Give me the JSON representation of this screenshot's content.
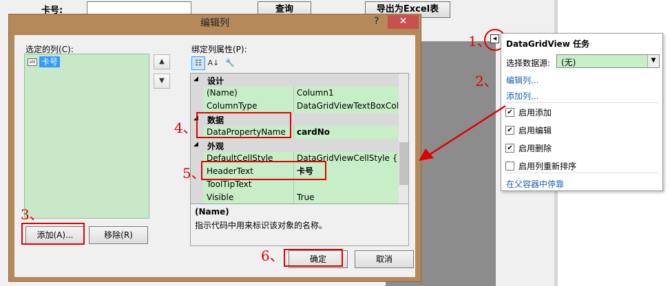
{
  "background_form": {
    "card_label": "卡号:",
    "query_button": "查询",
    "export_button": "导出为Excel表"
  },
  "dialog": {
    "title": "编辑列",
    "help_glyph": "?",
    "close_glyph": "✕",
    "selected_columns_label": "选定的列(C):",
    "list_items": [
      {
        "icon": "abl",
        "label": "卡号"
      }
    ],
    "move_up_glyph": "▲",
    "move_down_glyph": "▼",
    "bound_props_label": "绑定列属性(P):",
    "toolbar": {
      "categorized_glyph": "☷",
      "alphabetical_glyph": "A↓",
      "property_pages_glyph": "🔧"
    },
    "property_grid": {
      "rows": [
        {
          "kind": "category",
          "name": "设计"
        },
        {
          "kind": "prop",
          "name": "(Name)",
          "value": "Column1"
        },
        {
          "kind": "prop",
          "name": "ColumnType",
          "value": "DataGridViewTextBoxColu"
        },
        {
          "kind": "category",
          "name": "数据"
        },
        {
          "kind": "prop",
          "name": "DataPropertyName",
          "value": "cardNo",
          "bold": true
        },
        {
          "kind": "category",
          "name": "外观"
        },
        {
          "kind": "prop",
          "name": "DefaultCellStyle",
          "value": "DataGridViewCellStyle { }"
        },
        {
          "kind": "prop",
          "name": "HeaderText",
          "value": "卡号",
          "bold": true
        },
        {
          "kind": "prop",
          "name": "ToolTipText",
          "value": ""
        },
        {
          "kind": "prop",
          "name": "Visible",
          "value": "True"
        }
      ]
    },
    "description": {
      "title": "(Name)",
      "text": "指示代码中用来标识该对象的名称。"
    },
    "add_button": "添加(A)...",
    "remove_button": "移除(R)",
    "ok_button": "确定",
    "cancel_button": "取消"
  },
  "smart_tag": {
    "title": "DataGridView 任务",
    "datasource_label": "选择数据源:",
    "datasource_value": "(无)",
    "edit_columns_link": "编辑列...",
    "add_column_link": "添加列...",
    "checkboxes": [
      {
        "label": "启用添加",
        "checked": true
      },
      {
        "label": "启用编辑",
        "checked": true
      },
      {
        "label": "启用删除",
        "checked": true
      },
      {
        "label": "启用列重新排序",
        "checked": false
      }
    ],
    "dock_link": "在父容器中停靠"
  },
  "annotations": {
    "n1": "1、",
    "n2": "2、",
    "n3": "3、",
    "n4": "4、",
    "n5": "5、",
    "n6": "6、"
  },
  "colors": {
    "annotation_red": "#e00000",
    "dialog_frame": "#b5895a",
    "close_button": "#c75050",
    "property_highlight": "#c8eec8",
    "link_blue": "#1a5fb4"
  }
}
